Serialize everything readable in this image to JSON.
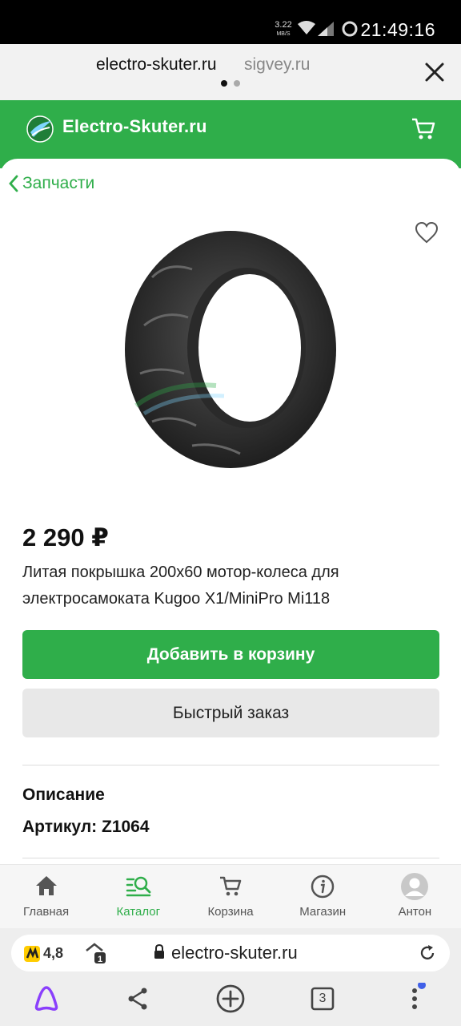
{
  "status_bar": {
    "speed_value": "3.22",
    "speed_unit": "MB/S",
    "time": "21:49:16"
  },
  "tabs": [
    {
      "label": "electro-skuter.ru"
    },
    {
      "label": "sigvey.ru"
    }
  ],
  "site_header": {
    "logo_text": "Electro-Skuter.ru"
  },
  "breadcrumb": {
    "label": "Запчасти"
  },
  "product": {
    "price": "2 290 ₽",
    "title": "Литая покрышка 200х60 мотор-колеса для электросамоката Kugoo X1/MiniPro Mi118",
    "add_to_cart_label": "Добавить в корзину",
    "quick_order_label": "Быстрый заказ",
    "description_heading": "Описание",
    "sku_line": "Артикул: Z1064"
  },
  "bottom_nav": [
    {
      "label": "Главная",
      "icon": "home-icon",
      "active": false
    },
    {
      "label": "Каталог",
      "icon": "catalog-search-icon",
      "active": true
    },
    {
      "label": "Корзина",
      "icon": "cart-icon",
      "active": false
    },
    {
      "label": "Магазин",
      "icon": "info-icon",
      "active": false
    },
    {
      "label": "Антон",
      "icon": "avatar-icon",
      "active": false
    }
  ],
  "address_bar": {
    "rating": "4,8",
    "protect_count": "1",
    "url": "electro-skuter.ru"
  },
  "browser_bar": {
    "tab_count": "3"
  },
  "colors": {
    "brand_green": "#2fae4a",
    "notification_dot": "#4060e8",
    "alice_purple": "#8a3ffc"
  }
}
